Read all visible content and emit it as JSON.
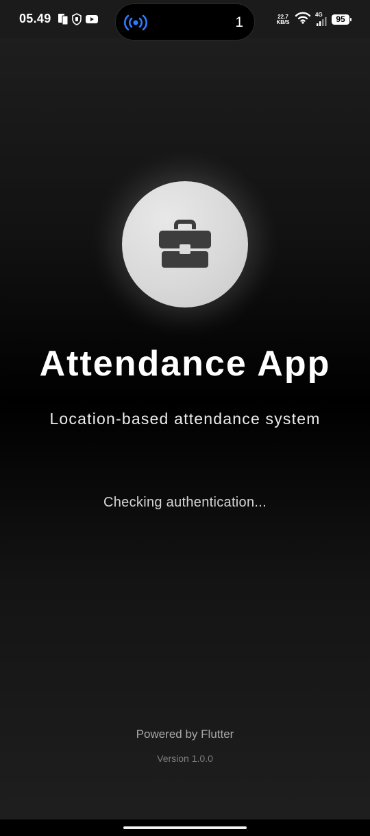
{
  "status_bar": {
    "time": "05.49",
    "left_icons": [
      "phone-card-icon",
      "shield-hand-icon",
      "youtube-icon"
    ],
    "island": {
      "icon": "broadcast-icon",
      "icon_color": "#2e7dff",
      "count": "1"
    },
    "net_speed_value": "22.7",
    "net_speed_unit": "KB/S",
    "wifi_icon": "wifi-icon",
    "network_type": "4G",
    "battery_level": "95"
  },
  "logo": {
    "icon": "briefcase-icon",
    "circle_color": "#dcdcdc",
    "icon_color": "#3d3d3d"
  },
  "app": {
    "title": "Attendance App",
    "subtitle": "Location-based attendance system",
    "loading_text": "Checking authentication...",
    "powered_by": "Powered by Flutter",
    "version": "Version 1.0.0"
  }
}
